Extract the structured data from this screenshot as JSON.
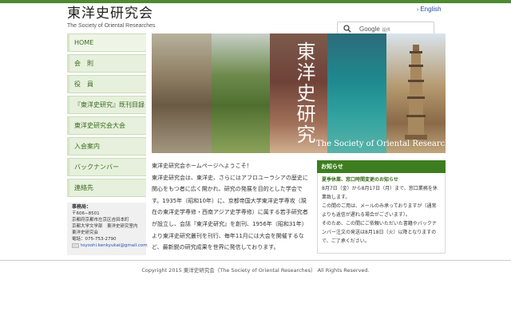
{
  "header": {
    "title_jp": "東洋史研究会",
    "title_en": "The Society of Oriental Researches",
    "lang_link": "English",
    "search_brand": "Google",
    "search_sub": "提供"
  },
  "sidebar": {
    "items": [
      {
        "label": "HOME"
      },
      {
        "label": "会　則"
      },
      {
        "label": "役　員"
      },
      {
        "label": "『東洋史研究』既刊目録"
      },
      {
        "label": "東洋史研究会大会"
      },
      {
        "label": "入会案内"
      },
      {
        "label": "バックナンバー"
      },
      {
        "label": "連絡先"
      }
    ]
  },
  "office": {
    "title": "事務局：",
    "lines": [
      "〒606−8501",
      "京都府京都市左京区吉田本町",
      "京都大学文学部　東洋史研究室内",
      "東洋史研究会",
      "電話：075-753-2790"
    ],
    "email": "toyoshi.kenkyukai@gmail.com"
  },
  "hero": {
    "calligraphy": "東洋史研究",
    "caption": "The Society of Oriental Researches"
  },
  "intro": {
    "text": "東洋史研究会ホームページへようこそ！\n東洋史研究会は、東洋史、さらにはアフロユーラシアの歴史に関心をもつ者に広く開かれ、研究の発展を目的とした学会です。1935年（昭和10年）に、京都帝国大学東洋史学専攻（現在の東洋史学専修・西南アジア史学専修）に属する若手研究者が設立し、会誌『東洋史研究』を創刊、1956年（昭和31年）より東洋史研究叢刊を刊行、毎年11月には大会を開催するなど、最新鋭の研究成果を世界に発信しております。"
  },
  "notice": {
    "heading": "お知らせ",
    "title": "夏季休業、窓口時間変更のお知らせ",
    "text": "8月7日（金）から8月17日（月）まで、窓口業務を休業致します。\nこの間のご用は、メールのみ承っておりますが（通常よりも返信が遅れる場合がございます）。\nそのため、この間にご依頼いただいた書籍やバックナンバー注文の発送は8月18日（火）以降となりますので、ご了承ください。"
  },
  "footer": {
    "copyright": "Copyright 2015 東洋史研究会（The Society of Oriental Researches） All Rights Reserved."
  },
  "colors": {
    "accent": "#3e7d1f",
    "nav_bg": "#e6f0dc",
    "link": "#2a4fa8"
  }
}
